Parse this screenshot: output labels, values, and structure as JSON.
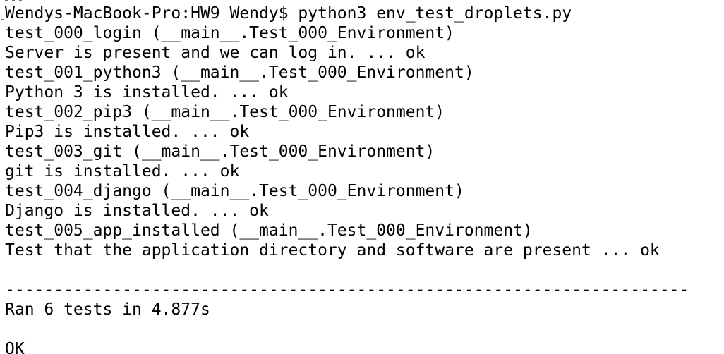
{
  "terminal": {
    "lines": [
      "Wendys-MacBook-Pro:HW9 Wendy$ python3 env_test_droplets.py",
      "test_000_login (__main__.Test_000_Environment)",
      "Server is present and we can log in. ... ok",
      "test_001_python3 (__main__.Test_000_Environment)",
      "Python 3 is installed. ... ok",
      "test_002_pip3 (__main__.Test_000_Environment)",
      "Pip3 is installed. ... ok",
      "test_003_git (__main__.Test_000_Environment)",
      "git is installed. ... ok",
      "test_004_django (__main__.Test_000_Environment)",
      "Django is installed. ... ok",
      "test_005_app_installed (__main__.Test_000_Environment)",
      "Test that the application directory and software are present ... ok",
      "",
      "----------------------------------------------------------------------",
      "Ran 6 tests in 4.877s",
      "",
      "OK"
    ]
  }
}
